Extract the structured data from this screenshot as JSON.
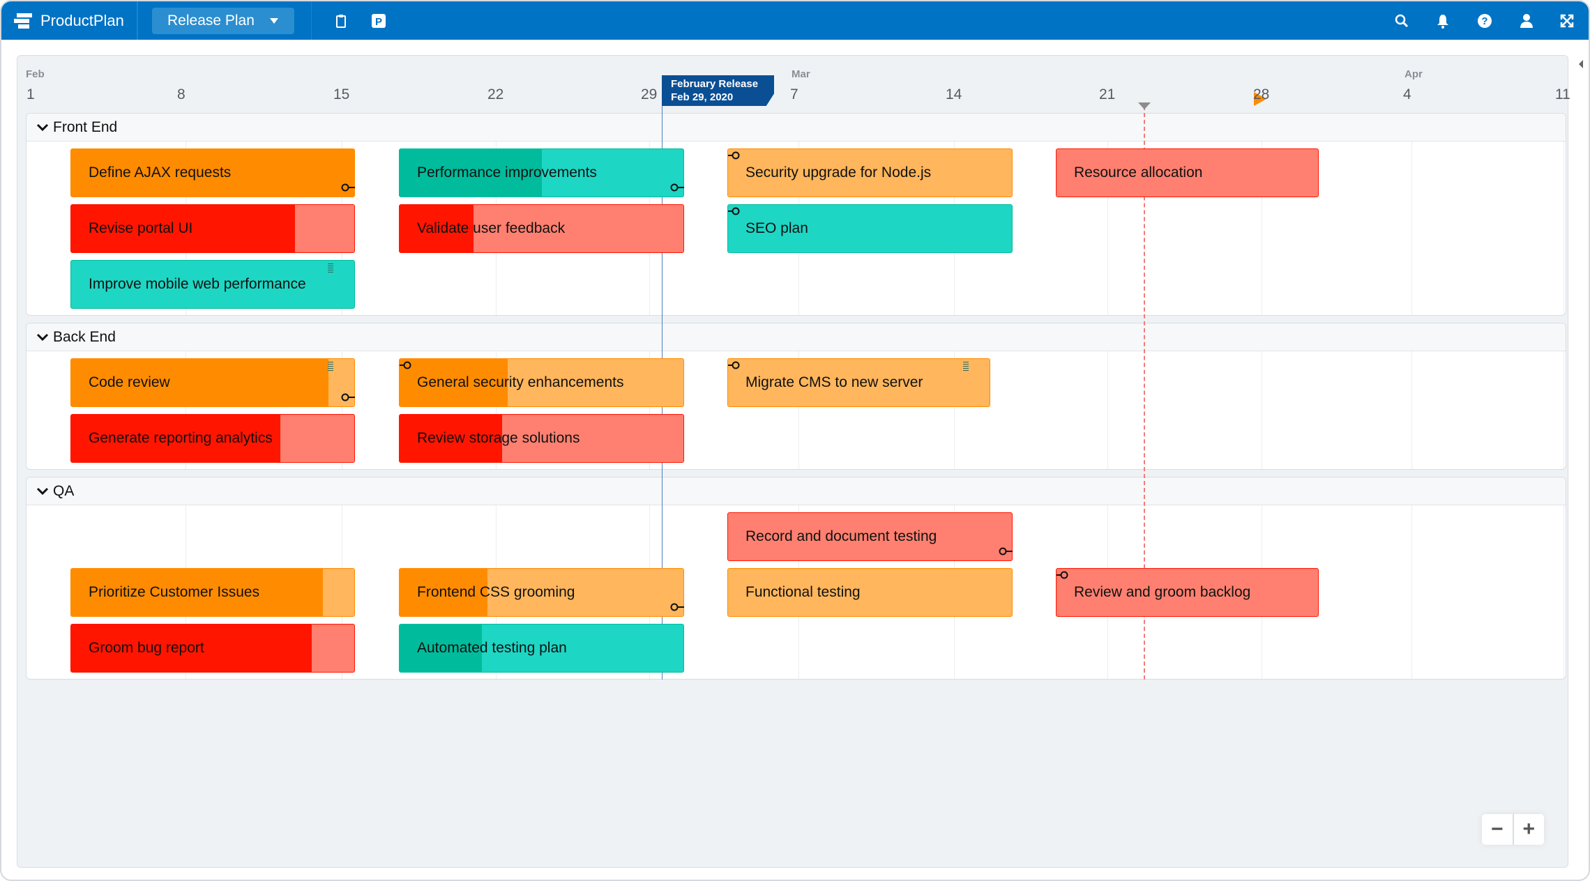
{
  "app": {
    "name": "ProductPlan",
    "plan_selector": "Release Plan"
  },
  "toolbar_icons": [
    "clipboard-icon",
    "parking-p-icon"
  ],
  "header_icons": [
    "search-icon",
    "bell-icon",
    "help-icon",
    "user-icon",
    "fullscreen-icon"
  ],
  "timeline": {
    "months": [
      {
        "label": "Feb"
      },
      {
        "label": "Mar"
      },
      {
        "label": "Apr"
      }
    ],
    "ticks": [
      "1",
      "8",
      "15",
      "22",
      "29",
      "7",
      "14",
      "21",
      "28",
      "4",
      "11"
    ],
    "release": {
      "name": "February Release",
      "date": "Feb 29, 2020"
    }
  },
  "colors": {
    "orange": "#ff8c00",
    "orange_light": "#ffb65c",
    "red": "#ff1500",
    "red_light": "#ff8070",
    "teal": "#00bc9c",
    "teal_light": "#1ed6c4",
    "accent": "#0073c4"
  },
  "lanes": [
    {
      "name": "Front End",
      "bars": [
        {
          "label": "Define AJAX requests",
          "color": "orange",
          "progress": 1.0,
          "connector": "end"
        },
        {
          "label": "Revise portal UI",
          "color": "red",
          "progress": 0.79
        },
        {
          "label": "Improve mobile web performance",
          "color": "teal",
          "progress": 0,
          "handle": true
        },
        {
          "label": "Performance improvements",
          "color": "teal",
          "progress": 0.5,
          "connector": "end"
        },
        {
          "label": "Validate user feedback",
          "color": "red",
          "progress": 0.26
        },
        {
          "label": "Security upgrade for Node.js",
          "color": "orange",
          "progress": 0,
          "connector": "start"
        },
        {
          "label": "SEO plan",
          "color": "teal",
          "progress": 0,
          "connector": "start"
        },
        {
          "label": "Resource allocation",
          "color": "red",
          "progress": 0
        }
      ]
    },
    {
      "name": "Back End",
      "bars": [
        {
          "label": "Code review",
          "color": "orange",
          "progress": 0.91,
          "connector": "end",
          "handle": true
        },
        {
          "label": "Generate reporting analytics",
          "color": "red",
          "progress": 0.74
        },
        {
          "label": "General security enhancements",
          "color": "orange",
          "progress": 0.38,
          "connector": "start"
        },
        {
          "label": "Review storage solutions",
          "color": "red",
          "progress": 0.36
        },
        {
          "label": "Migrate CMS to new server",
          "color": "orange",
          "progress": 0,
          "connector": "start",
          "handle": true
        }
      ]
    },
    {
      "name": "QA",
      "bars": [
        {
          "label": "Prioritize Customer Issues",
          "color": "orange",
          "progress": 0.89
        },
        {
          "label": "Groom bug report",
          "color": "red",
          "progress": 0.85
        },
        {
          "label": "Frontend CSS grooming",
          "color": "orange",
          "progress": 0.31,
          "connector": "end"
        },
        {
          "label": "Automated testing plan",
          "color": "teal",
          "progress": 0.29
        },
        {
          "label": "Record and document testing",
          "color": "red",
          "progress": 0,
          "connector": "end"
        },
        {
          "label": "Functional testing",
          "color": "orange",
          "progress": 0
        },
        {
          "label": "Review and groom backlog",
          "color": "red",
          "progress": 0,
          "connector": "start"
        }
      ]
    }
  ],
  "zoom": {
    "out": "−",
    "in": "+"
  }
}
